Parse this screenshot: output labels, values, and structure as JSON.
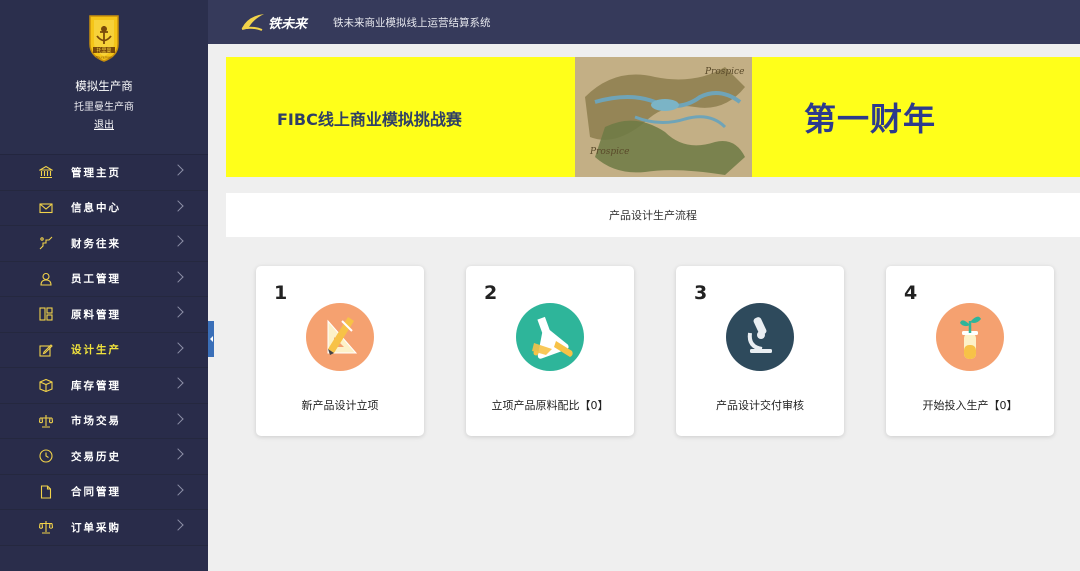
{
  "app": {
    "brand_text": "铁未来",
    "system_title": "铁未来商业模拟线上运营结算系统",
    "brand_color": "#f2d34a"
  },
  "profile": {
    "logo_text": "托里曼",
    "logo_subtext": "Toureman",
    "company_name": "模拟生产商",
    "company_sub": "托里曼生产商",
    "logout_label": "退出"
  },
  "sidebar": {
    "items": [
      {
        "label": "管理主页",
        "icon": "bank-icon"
      },
      {
        "label": "信息中心",
        "icon": "mail-icon"
      },
      {
        "label": "财务往来",
        "icon": "stairs-icon"
      },
      {
        "label": "员工管理",
        "icon": "user-icon"
      },
      {
        "label": "原料管理",
        "icon": "grid-icon"
      },
      {
        "label": "设计生产",
        "icon": "edit-icon",
        "active": true
      },
      {
        "label": "库存管理",
        "icon": "box-icon"
      },
      {
        "label": "市场交易",
        "icon": "scale-icon"
      },
      {
        "label": "交易历史",
        "icon": "clock-icon"
      },
      {
        "label": "合同管理",
        "icon": "document-icon"
      },
      {
        "label": "订单采购",
        "icon": "balance-icon"
      }
    ]
  },
  "banner": {
    "left_text": "FIBC线上商业模拟挑战赛",
    "right_text": "第一财年",
    "background": "#ffff1a",
    "map_labels": [
      "Prospice",
      "Prospice"
    ]
  },
  "section": {
    "title": "产品设计生产流程"
  },
  "cards": [
    {
      "number": "1",
      "label": "新产品设计立项",
      "icon": "ruler-icon",
      "color": "#f5a170"
    },
    {
      "number": "2",
      "label": "立项产品原料配比【0】",
      "icon": "flask-icon",
      "color": "#2eb59a"
    },
    {
      "number": "3",
      "label": "产品设计交付审核",
      "icon": "microscope-icon",
      "color": "#2e4a5c"
    },
    {
      "number": "4",
      "label": "开始投入生产【0】",
      "icon": "plant-tube-icon",
      "color": "#f5a170"
    }
  ]
}
